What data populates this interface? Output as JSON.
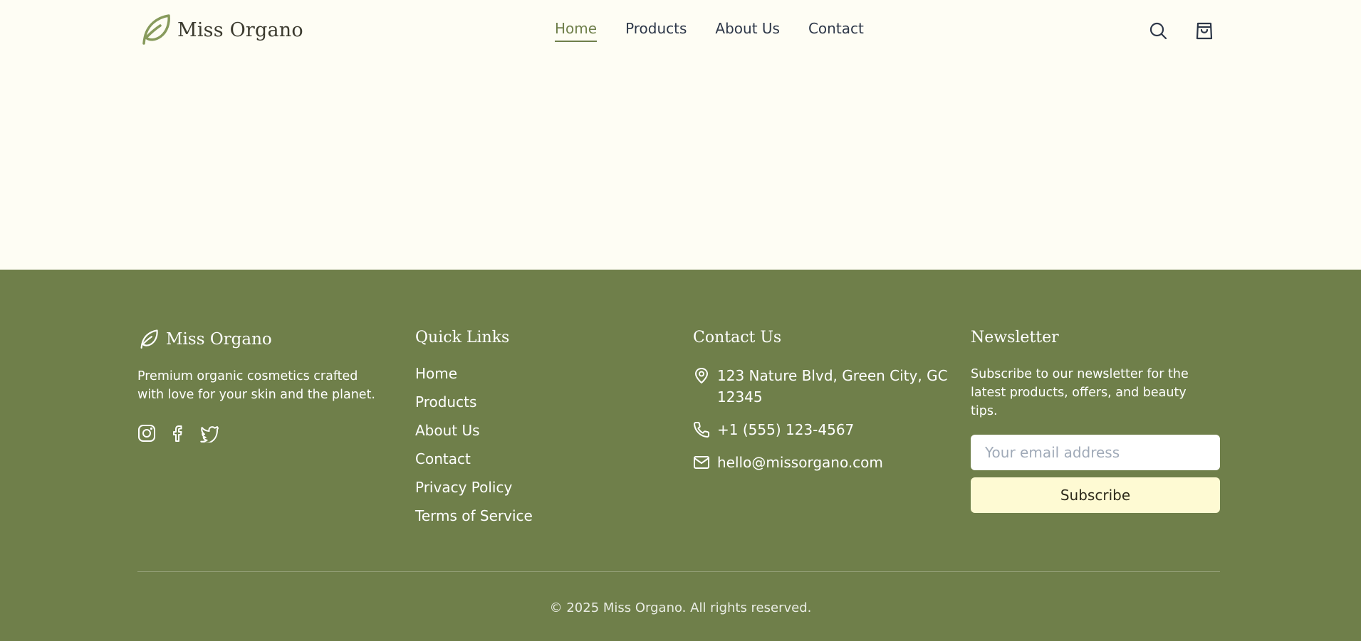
{
  "header": {
    "brand_name": "Miss Organo",
    "nav": [
      {
        "label": "Home",
        "active": true
      },
      {
        "label": "Products"
      },
      {
        "label": "About Us"
      },
      {
        "label": "Contact"
      }
    ],
    "icons": [
      "search-icon",
      "shopping-bag-icon"
    ]
  },
  "footer": {
    "brand": {
      "name": "Miss Organo",
      "description": "Premium organic cosmetics crafted with love for your skin and the planet.",
      "social": [
        "instagram-icon",
        "facebook-icon",
        "twitter-icon"
      ]
    },
    "quick_links": {
      "title": "Quick Links",
      "items": [
        "Home",
        "Products",
        "About Us",
        "Contact",
        "Privacy Policy",
        "Terms of Service"
      ]
    },
    "contact": {
      "title": "Contact Us",
      "address": "123 Nature Blvd, Green City, GC 12345",
      "phone": "+1 (555) 123-4567",
      "email": "hello@missorgano.com"
    },
    "newsletter": {
      "title": "Newsletter",
      "description": "Subscribe to our newsletter for the latest products, offers, and beauty tips.",
      "email_placeholder": "Your email address",
      "subscribe_label": "Subscribe"
    },
    "copyright": "© 2025 Miss Organo. All rights reserved."
  },
  "colors": {
    "page_bg": "#fefdf4",
    "brand_green": "#6f7f4a",
    "button_bg": "#fefad3",
    "text_dark": "#2d3748"
  }
}
